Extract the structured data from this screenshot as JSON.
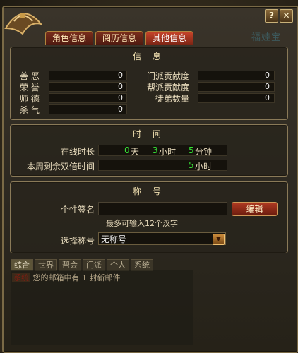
{
  "window": {
    "help_label": "?",
    "close_label": "✕",
    "watermark": "福娃宝"
  },
  "tabs": [
    {
      "label": "角色信息",
      "active": false
    },
    {
      "label": "阅历信息",
      "active": false
    },
    {
      "label": "其他信息",
      "active": true
    }
  ],
  "info": {
    "title": "信 息",
    "left": [
      {
        "label": "善  恶",
        "value": "0"
      },
      {
        "label": "荣  誉",
        "value": "0"
      },
      {
        "label": "师  德",
        "value": "0"
      },
      {
        "label": "杀  气",
        "value": "0"
      }
    ],
    "right": [
      {
        "label": "门派贡献度",
        "value": "0"
      },
      {
        "label": "帮派贡献度",
        "value": "0"
      },
      {
        "label": "徒弟数量",
        "value": "0"
      }
    ]
  },
  "time": {
    "title": "时 间",
    "online_label": "在线时长",
    "online_days": "0",
    "days_unit": "天",
    "online_hours": "3",
    "hours_unit": "小时",
    "online_minutes": "5",
    "minutes_unit": "分钟",
    "double_label": "本周剩余双倍时间",
    "double_hours": "5",
    "double_unit": "小时"
  },
  "title_section": {
    "title": "称 号",
    "signature_label": "个性签名",
    "signature_value": "",
    "edit_label": "编辑",
    "hint": "最多可输入12个汉字",
    "select_label": "选择称号",
    "selected": "无称号"
  },
  "chat": {
    "tabs": [
      {
        "label": "综合",
        "active": true
      },
      {
        "label": "世界",
        "active": false
      },
      {
        "label": "帮会",
        "active": false
      },
      {
        "label": "门派",
        "active": false
      },
      {
        "label": "个人",
        "active": false
      },
      {
        "label": "系统",
        "active": false
      }
    ],
    "message_tag": "系统",
    "message": "您的邮箱中有 1 封新邮件"
  },
  "colors": {
    "accent_green": "#35e335",
    "tab_active": "#c8442a",
    "panel_border": "#8a7a58"
  }
}
